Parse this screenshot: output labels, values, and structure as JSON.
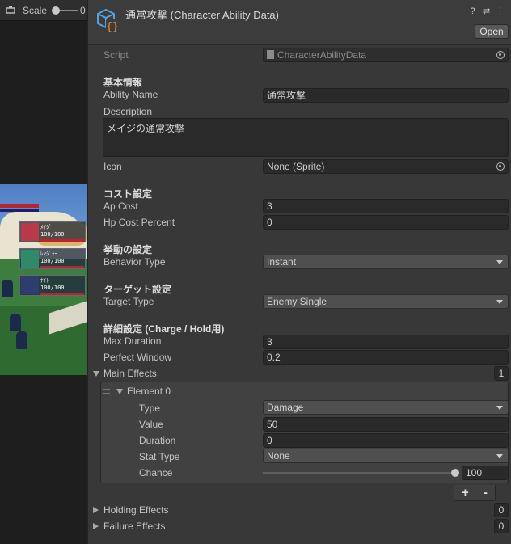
{
  "scene_toolbar": {
    "scale_label": "Scale",
    "scale_value": "0"
  },
  "game_view": {
    "party": [
      {
        "name": "ﾒｲｼﾞ",
        "hp": "100/100"
      },
      {
        "name": "ﾚﾝｼﾞｬｰ",
        "hp": "100/100"
      },
      {
        "name": "ﾅｲﾄ",
        "hp": "100/100"
      }
    ]
  },
  "inspector": {
    "title": "通常攻撃 (Character Ability Data)",
    "open_label": "Open",
    "script": {
      "label": "Script",
      "value": "CharacterAbilityData"
    },
    "basic_section": "基本情報",
    "ability_name": {
      "label": "Ability Name",
      "value": "通常攻撃"
    },
    "description": {
      "label": "Description",
      "value": "メイジの通常攻撃"
    },
    "icon": {
      "label": "Icon",
      "value": "None (Sprite)"
    },
    "cost_section": "コスト設定",
    "ap_cost": {
      "label": "Ap Cost",
      "value": "3"
    },
    "hp_cost_percent": {
      "label": "Hp Cost Percent",
      "value": "0"
    },
    "behavior_section": "挙動の設定",
    "behavior_type": {
      "label": "Behavior Type",
      "value": "Instant"
    },
    "target_section": "ターゲット設定",
    "target_type": {
      "label": "Target Type",
      "value": "Enemy Single"
    },
    "detail_section": "詳細設定 (Charge / Hold用)",
    "max_duration": {
      "label": "Max Duration",
      "value": "3"
    },
    "perfect_window": {
      "label": "Perfect Window",
      "value": "0.2"
    },
    "main_effects": {
      "label": "Main Effects",
      "count": "1",
      "element": {
        "label": "Element 0",
        "type": {
          "label": "Type",
          "value": "Damage"
        },
        "value": {
          "label": "Value",
          "value": "50"
        },
        "duration": {
          "label": "Duration",
          "value": "0"
        },
        "stat_type": {
          "label": "Stat Type",
          "value": "None"
        },
        "chance": {
          "label": "Chance",
          "value": "100",
          "slider_fraction": 1.0
        }
      }
    },
    "list_buttons": {
      "add": "+",
      "remove": "-"
    },
    "holding_effects": {
      "label": "Holding Effects",
      "count": "0"
    },
    "failure_effects": {
      "label": "Failure Effects",
      "count": "0"
    }
  },
  "colors": {
    "inspector_bg": "#383838",
    "field_bg": "#2a2a2a",
    "dropdown_bg": "#4f4f4f",
    "asset_icon_blue": "#4fa3e0",
    "asset_icon_orange": "#f0902a"
  }
}
